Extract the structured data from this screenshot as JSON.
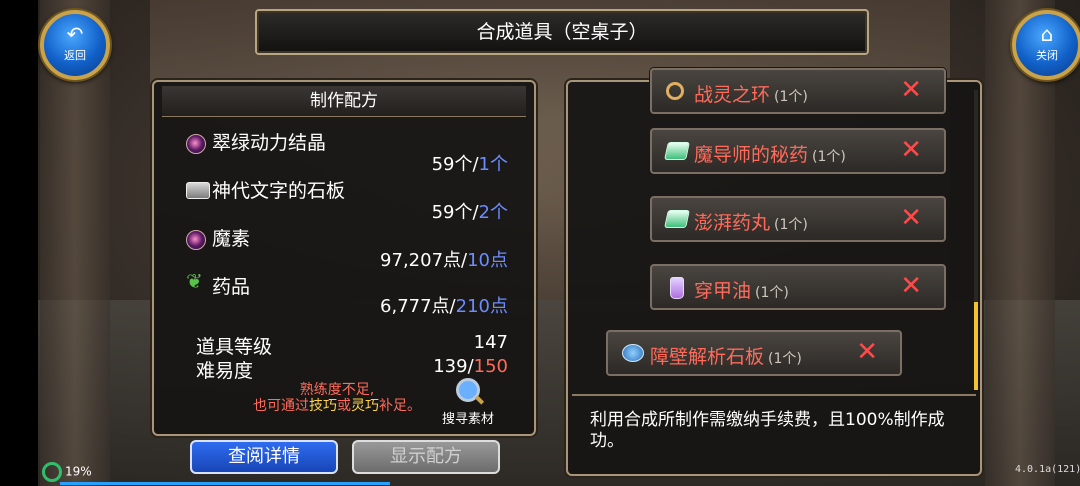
{
  "window_title": "合成道具（空桌子）",
  "top_buttons": {
    "back": {
      "label": "返回",
      "icon": "back-arrow-icon"
    },
    "close": {
      "label": "关闭",
      "icon": "home-icon"
    }
  },
  "recipe": {
    "header": "制作配方",
    "materials": [
      {
        "icon": "orb-icon",
        "name": "翠绿动力结晶",
        "have": "59个/",
        "need": "1个"
      },
      {
        "icon": "stone-slab-icon",
        "name": "神代文字的石板",
        "have": "59个/",
        "need": "2个"
      },
      {
        "icon": "orb-icon",
        "name": "魔素",
        "have": "97,207点/",
        "need": "10点"
      },
      {
        "icon": "herb-icon",
        "name": "药品",
        "have": "6,777点/",
        "need": "210点"
      }
    ],
    "item_level_label": "道具等级",
    "item_level_value": "147",
    "difficulty_label": "难易度",
    "difficulty_have": "139/",
    "difficulty_need": "150",
    "warning_line1": "熟练度不足,",
    "warning_line2_a": "也可通过",
    "warning_line2_skill": "技巧",
    "warning_line2_or": "或",
    "warning_line2_dex": "灵巧",
    "warning_line2_b": "补足。",
    "search_label": "搜寻素材"
  },
  "buttons": {
    "detail": "查阅详情",
    "show_recipe": "显示配方"
  },
  "item_list": [
    {
      "icon": "ring-icon",
      "name": "战灵之环",
      "qty": "(1个)"
    },
    {
      "icon": "potion-icon",
      "name": "魔导师的秘药",
      "qty": "(1个)"
    },
    {
      "icon": "potion-icon",
      "name": "澎湃药丸",
      "qty": "(1个)"
    },
    {
      "icon": "bottle-icon",
      "name": "穿甲油",
      "qty": "(1个)"
    },
    {
      "icon": "stone-icon",
      "name": "障壁解析石板",
      "qty": "(1个)"
    }
  ],
  "description": "利用合成所制作需缴纳手续费，且100%制作成功。",
  "status": {
    "battery": "19%",
    "version": "4.0.1a(121)"
  },
  "colors": {
    "need_blue": "#6c8cff",
    "warning_red": "#ff6a5a",
    "highlight_yellow": "#ffd24a",
    "scroll_yellow": "#f2c230"
  }
}
